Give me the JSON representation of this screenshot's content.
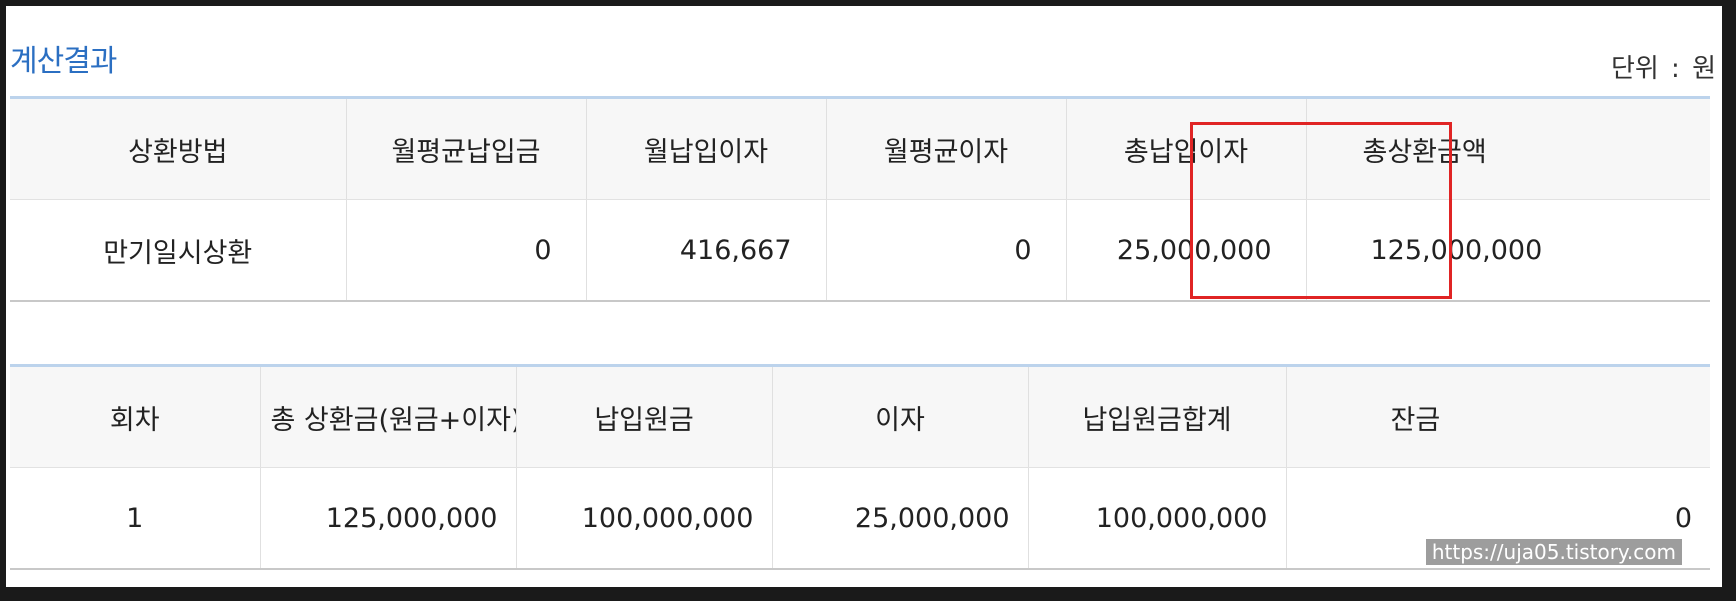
{
  "section": {
    "title": "계산결과",
    "unit_label": "단위",
    "unit_sep": ":",
    "unit_value": "원"
  },
  "summary_table": {
    "headers": [
      "상환방법",
      "월평균납입금",
      "월납입이자",
      "월평균이자",
      "총납입이자",
      "총상환금액"
    ],
    "row": [
      "만기일시상환",
      "0",
      "416,667",
      "0",
      "25,000,000",
      "125,000,000"
    ]
  },
  "schedule_table": {
    "headers": [
      "회차",
      "총 상환금(원금+이자)",
      "납입원금",
      "이자",
      "납입원금합계",
      "잔금"
    ],
    "rows": [
      [
        "1",
        "125,000,000",
        "100,000,000",
        "25,000,000",
        "100,000,000",
        "0"
      ]
    ]
  },
  "watermark": "https://uja05.tistory.com",
  "colors": {
    "title": "#2b6fc2",
    "highlight": "#e02424",
    "table_rule": "#bcd3ec"
  }
}
